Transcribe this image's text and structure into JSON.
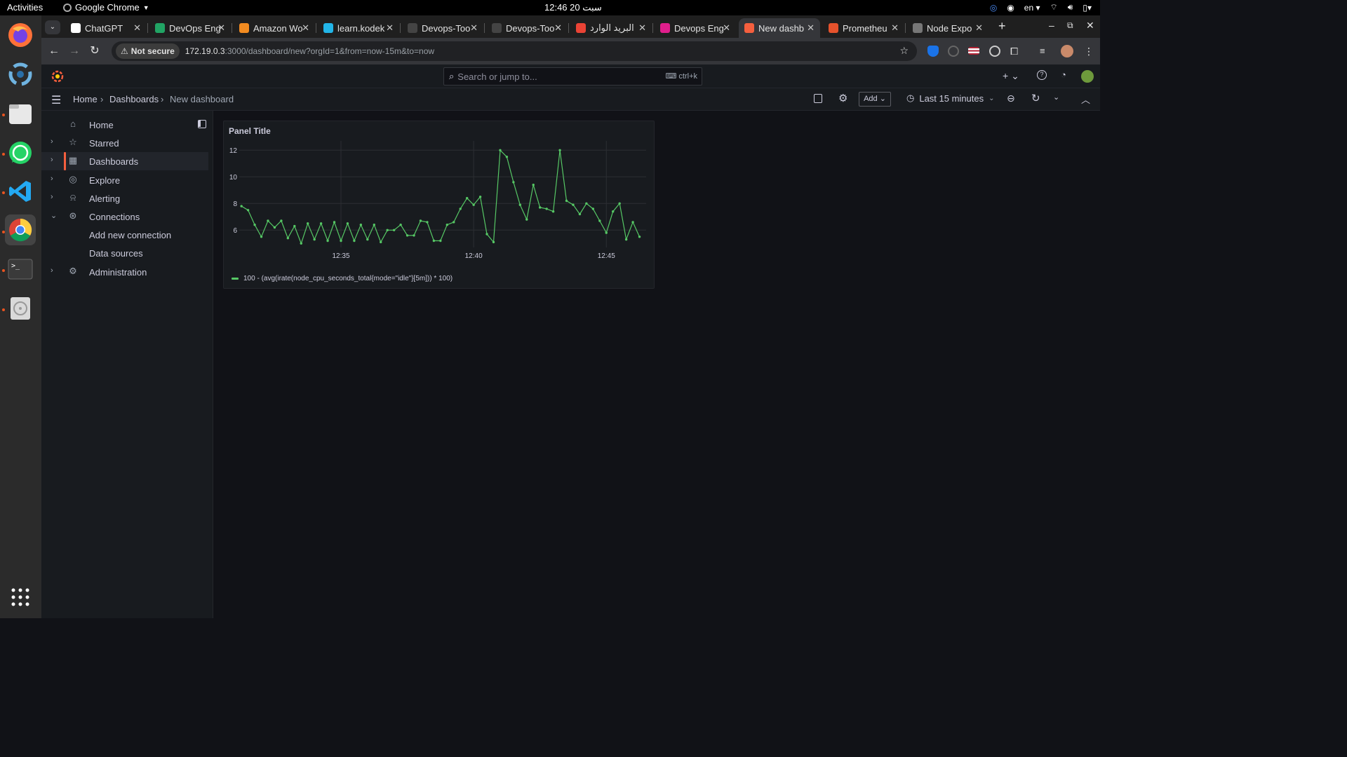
{
  "os": {
    "activities": "Activities",
    "app_name": "Google Chrome",
    "clock": "12:46  سبت 20",
    "lang": "en"
  },
  "tabs": [
    {
      "label": "ChatGPT",
      "color": "#ffffff"
    },
    {
      "label": "DevOps Eng",
      "color": "#21a464"
    },
    {
      "label": "Amazon Wo",
      "color": "#f28b20"
    },
    {
      "label": "learn.kodek",
      "color": "#22b5e8"
    },
    {
      "label": "Devops-Too",
      "color": "#444444"
    },
    {
      "label": "Devops-Too",
      "color": "#444444"
    },
    {
      "label": "البريد الوارد",
      "color": "#ea4335"
    },
    {
      "label": "Devops Eng",
      "color": "#e01e8c"
    },
    {
      "label": "New dashb",
      "color": "#f55f3e",
      "active": true
    },
    {
      "label": "Prometheu",
      "color": "#e6522c"
    },
    {
      "label": "Node Expo",
      "color": "#777777"
    }
  ],
  "address": {
    "security": "Not secure",
    "host": "172.19.0.3",
    "path": ":3000/dashboard/new?orgId=1&from=now-15m&to=now"
  },
  "grafana": {
    "search_placeholder": "Search or jump to...",
    "search_shortcut": "ctrl+k",
    "breadcrumb": [
      "Home",
      "Dashboards",
      "New dashboard"
    ],
    "add_label": "Add",
    "time_range": "Last 15 minutes",
    "nav": [
      {
        "label": "Home",
        "icon": "home-icon"
      },
      {
        "label": "Starred",
        "icon": "star-icon"
      },
      {
        "label": "Dashboards",
        "icon": "apps-icon",
        "active": true
      },
      {
        "label": "Explore",
        "icon": "compass-icon"
      },
      {
        "label": "Alerting",
        "icon": "bell-icon"
      },
      {
        "label": "Connections",
        "icon": "connections-icon",
        "expanded": true
      },
      {
        "label": "Add new connection",
        "sub": true
      },
      {
        "label": "Data sources",
        "sub": true
      },
      {
        "label": "Administration",
        "icon": "gear-icon"
      }
    ],
    "panel_title": "Panel Title"
  },
  "chart_data": {
    "type": "line",
    "title": "Panel Title",
    "x_tick_labels": [
      "12:35",
      "12:40",
      "12:45"
    ],
    "y_ticks": [
      6,
      8,
      10,
      12
    ],
    "ylim": [
      4.7,
      12.7
    ],
    "xlim": [
      "12:31:10",
      "12:46:30"
    ],
    "grid": true,
    "legend_position": "bottom-left",
    "series": [
      {
        "name": "100 - (avg(irate(node_cpu_seconds_total{mode=\"idle\"}[5m])) * 100)",
        "color": "#56c865",
        "x": [
          "12:31:15",
          "12:31:30",
          "12:31:45",
          "12:32:00",
          "12:32:15",
          "12:32:30",
          "12:32:45",
          "12:33:00",
          "12:33:15",
          "12:33:30",
          "12:33:45",
          "12:34:00",
          "12:34:15",
          "12:34:30",
          "12:34:45",
          "12:35:00",
          "12:35:15",
          "12:35:30",
          "12:35:45",
          "12:36:00",
          "12:36:15",
          "12:36:30",
          "12:36:45",
          "12:37:00",
          "12:37:15",
          "12:37:30",
          "12:37:45",
          "12:38:00",
          "12:38:15",
          "12:38:30",
          "12:38:45",
          "12:39:00",
          "12:39:15",
          "12:39:30",
          "12:39:45",
          "12:40:00",
          "12:40:15",
          "12:40:30",
          "12:40:45",
          "12:41:00",
          "12:41:15",
          "12:41:30",
          "12:41:45",
          "12:42:00",
          "12:42:15",
          "12:42:30",
          "12:42:45",
          "12:43:00",
          "12:43:15",
          "12:43:30",
          "12:43:45",
          "12:44:00",
          "12:44:15",
          "12:44:30",
          "12:44:45",
          "12:45:00",
          "12:45:15",
          "12:45:30",
          "12:45:45",
          "12:46:00",
          "12:46:15"
        ],
        "values": [
          7.8,
          7.5,
          6.4,
          5.5,
          6.7,
          6.2,
          6.7,
          5.4,
          6.3,
          5.0,
          6.5,
          5.3,
          6.5,
          5.2,
          6.6,
          5.2,
          6.5,
          5.2,
          6.4,
          5.3,
          6.4,
          5.1,
          6.0,
          6.0,
          6.4,
          5.6,
          5.6,
          6.7,
          6.6,
          5.2,
          5.2,
          6.4,
          6.6,
          7.6,
          8.4,
          7.9,
          8.5,
          5.7,
          5.1,
          12.0,
          11.5,
          9.6,
          7.9,
          6.8,
          9.4,
          7.7,
          7.6,
          7.4,
          12.0,
          8.2,
          7.9,
          7.2,
          8.0,
          7.6,
          6.7,
          5.8,
          7.4,
          8.0,
          5.3,
          6.6,
          5.5
        ]
      }
    ]
  }
}
